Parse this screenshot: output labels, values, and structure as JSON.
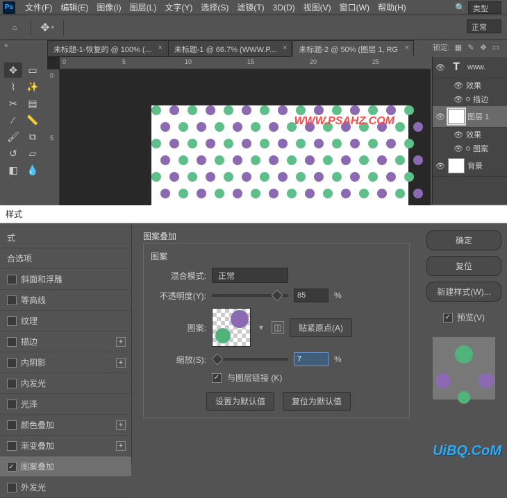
{
  "menu": {
    "items": [
      "文件(F)",
      "编辑(E)",
      "图像(I)",
      "图层(L)",
      "文字(Y)",
      "选择(S)",
      "滤镜(T)",
      "3D(D)",
      "视图(V)",
      "窗口(W)",
      "帮助(H)"
    ]
  },
  "search": {
    "type_label": "类型"
  },
  "toolbar": {
    "blend_mode": "正常",
    "lock_label": "锁定:"
  },
  "tabs": {
    "t0": "未标题-1-恢复的 @ 100% (...",
    "t1": "未标题-1 @ 66.7% (WWW.P...",
    "t2": "未标题-2 @ 50% (图层 1, RG"
  },
  "ruler": {
    "m0": "0",
    "m5": "5",
    "m10": "10",
    "m15": "15",
    "m20": "20",
    "m25": "25",
    "v0": "0",
    "v5": "5"
  },
  "canvas": {
    "watermark": "WWW.PSAHZ.COM"
  },
  "layers": {
    "l0": "www.",
    "l0fx": "效果",
    "l0fx1": "描边",
    "l1": "图层 1",
    "l1fx": "效果",
    "l1fx1": "图案",
    "l2": "背景"
  },
  "style_dialog": {
    "title": "样式",
    "sidebar": {
      "s0": "式",
      "s1": "合选项",
      "s2": "斜面和浮雕",
      "s3": "等高线",
      "s4": "纹理",
      "s5": "描边",
      "s6": "内阴影",
      "s7": "内发光",
      "s8": "光泽",
      "s9": "颜色叠加",
      "s10": "渐变叠加",
      "s11": "图案叠加",
      "s12": "外发光"
    },
    "section": "图案叠加",
    "fieldset": "图案",
    "blend_label": "混合模式:",
    "blend_value": "正常",
    "opacity_label": "不透明度(Y):",
    "opacity_value": "85",
    "percent": "%",
    "pattern_label": "图案:",
    "snap_btn": "贴紧原点(A)",
    "scale_label": "缩放(S):",
    "scale_value": "7",
    "link_label": "与图层链接 (K)",
    "default_btn": "设置为默认值",
    "reset_btn": "复位为默认值"
  },
  "right": {
    "ok": "确定",
    "reset": "复位",
    "newstyle": "新建样式(W)...",
    "preview": "预览(V)"
  },
  "watermark2": "UiBQ.CoM"
}
